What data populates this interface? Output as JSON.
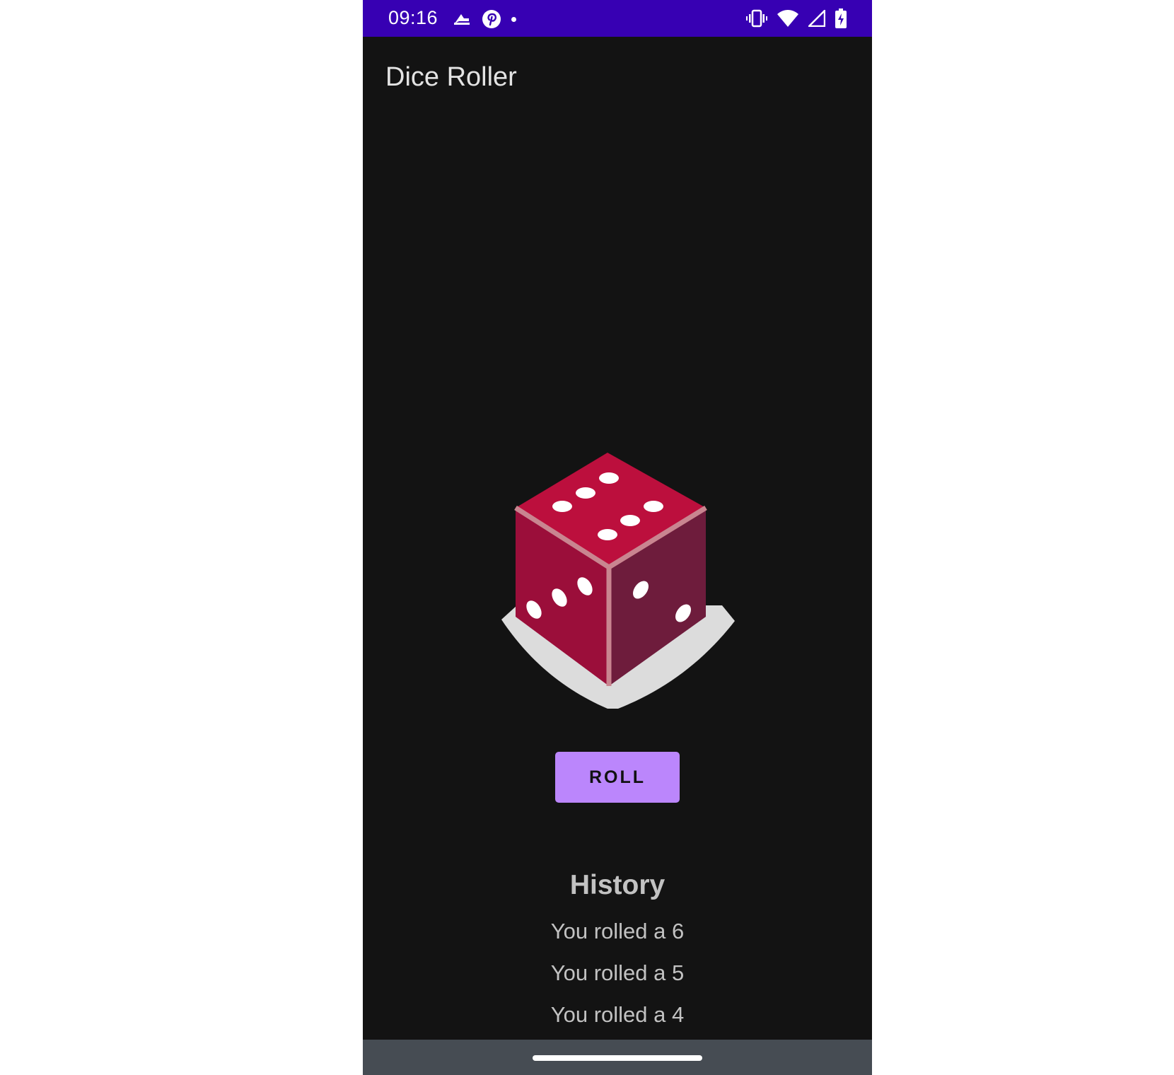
{
  "status_bar": {
    "time": "09:16",
    "background_color": "#3700b3",
    "left_icons": [
      "notification-arrow-icon",
      "pinterest-icon",
      "more-notifications-dot-icon"
    ],
    "right_icons": [
      "vibrate-icon",
      "wifi-icon",
      "cellular-signal-icon",
      "battery-charging-icon"
    ]
  },
  "app": {
    "title": "Dice Roller",
    "background_color": "#131313"
  },
  "dice": {
    "icon": "dice-icon",
    "top_face_pips": 6,
    "left_face_pips": 3,
    "right_face_pips": 2,
    "colors": {
      "top": "#bc0f3d",
      "left": "#9b0e3a",
      "right": "#6e1c3c",
      "edge": "#c98590",
      "shadow": "#dcdcdc",
      "pip": "#ffffff"
    }
  },
  "roll_button": {
    "label": "ROLL",
    "color": "#bb86fc"
  },
  "history": {
    "title": "History",
    "items": [
      "You rolled a 6",
      "You rolled a 5",
      "You rolled a 4"
    ]
  },
  "nav_bar": {
    "background_color": "#464c53",
    "home_handle": "home-gesture-handle"
  }
}
